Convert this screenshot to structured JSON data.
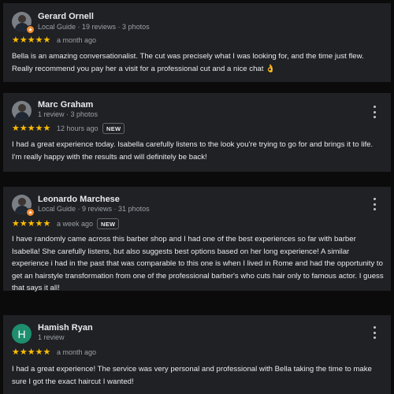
{
  "colors": {
    "star": "#fbbc04",
    "local_guide_badge": "#f28b30",
    "avatar_h": "#1e8e6e"
  },
  "reviews": [
    {
      "name": "Gerard Ornell",
      "meta": "Local Guide · 19 reviews · 3 photos",
      "stars": "★★★★★",
      "rating": 5,
      "time": "a month ago",
      "text": "Bella is an amazing conversationalist. The cut was precisely what I was looking for, and the time just flew. Really recommend you pay her a visit for a professional cut and a nice chat 👌"
    },
    {
      "name": "Marc Graham",
      "meta": "1 review · 3 photos",
      "stars": "★★★★★",
      "rating": 5,
      "time": "12 hours ago",
      "badge": "NEW",
      "text": "I had a great experience today. Isabella carefully listens to the look you're trying to go for and brings it to life. I'm really happy with the results and will definitely be back!"
    },
    {
      "name": "Leonardo Marchese",
      "meta": "Local Guide · 9 reviews · 31 photos",
      "stars": "★★★★★",
      "rating": 5,
      "time": "a week ago",
      "badge": "NEW",
      "text": "I have randomly came across this barber shop and I had one of the best experiences so far with barber Isabella! She carefully listens, but also suggests best options based on her long experience! A similar experience i had in the past that was comparable to this one is when I lived in Rome and had the opportunity to get an hairstyle transformation from one of the professional barber's who cuts hair only to famous actor. I guess that says it all!"
    },
    {
      "name": "Hamish Ryan",
      "avatar_letter": "H",
      "meta": "1 review",
      "stars": "★★★★★",
      "rating": 5,
      "time": "a month ago",
      "text": "I had a great experience! The service was very personal and professional with Bella taking the time to make sure I got the exact haircut I wanted!"
    }
  ]
}
